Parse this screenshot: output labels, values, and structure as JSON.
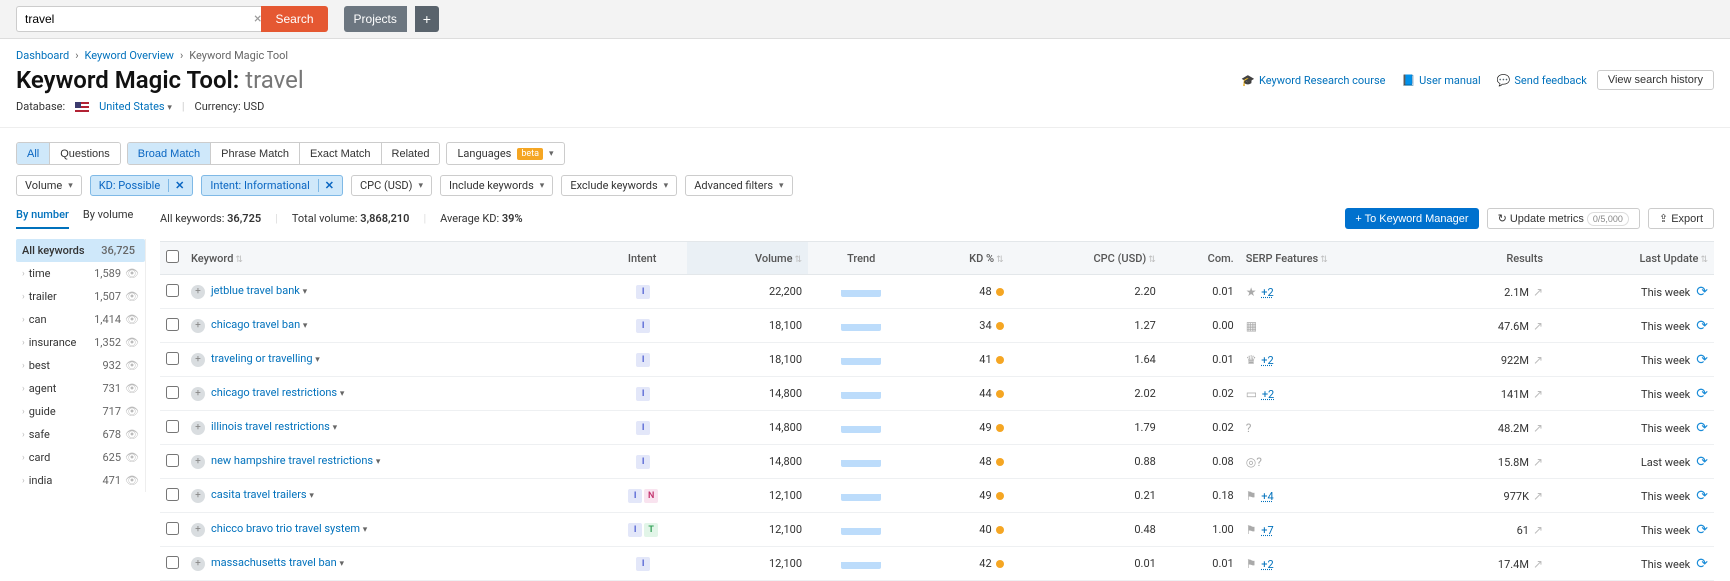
{
  "search": {
    "value": "travel",
    "search_btn": "Search",
    "projects_btn": "Projects"
  },
  "breadcrumb": {
    "a": "Dashboard",
    "b": "Keyword Overview",
    "c": "Keyword Magic Tool"
  },
  "title": {
    "tool": "Keyword Magic Tool:",
    "term": "travel"
  },
  "header_links": {
    "course": "Keyword Research course",
    "manual": "User manual",
    "feedback": "Send feedback",
    "history": "View search history"
  },
  "subhead": {
    "db_label": "Database:",
    "db_value": "United States",
    "cur_label": "Currency:",
    "cur_value": "USD"
  },
  "match_tabs": [
    "All",
    "Questions",
    "Broad Match",
    "Phrase Match",
    "Exact Match",
    "Related"
  ],
  "lang_label": "Languages",
  "filters": {
    "volume": "Volume",
    "kd": "KD: Possible",
    "intent": "Intent: Informational",
    "cpc": "CPC (USD)",
    "include": "Include keywords",
    "exclude": "Exclude keywords",
    "advanced": "Advanced filters"
  },
  "group_meta": {
    "by_number": "By number",
    "by_volume": "By volume",
    "all_keywords": "All keywords",
    "all_count": "36,725"
  },
  "groups": [
    {
      "name": "time",
      "count": "1,589"
    },
    {
      "name": "trailer",
      "count": "1,507"
    },
    {
      "name": "can",
      "count": "1,414"
    },
    {
      "name": "insurance",
      "count": "1,352"
    },
    {
      "name": "best",
      "count": "932"
    },
    {
      "name": "agent",
      "count": "731"
    },
    {
      "name": "guide",
      "count": "717"
    },
    {
      "name": "safe",
      "count": "678"
    },
    {
      "name": "card",
      "count": "625"
    },
    {
      "name": "india",
      "count": "471"
    }
  ],
  "summary": {
    "all_kw_lbl": "All keywords:",
    "all_kw_val": "36,725",
    "tot_vol_lbl": "Total volume:",
    "tot_vol_val": "3,868,210",
    "avg_kd_lbl": "Average KD:",
    "avg_kd_val": "39%",
    "to_km": "To Keyword Manager",
    "update": "Update metrics",
    "update_count": "0/5,000",
    "export": "Export"
  },
  "cols": {
    "keyword": "Keyword",
    "intent": "Intent",
    "volume": "Volume",
    "trend": "Trend",
    "kd": "KD %",
    "cpc": "CPC (USD)",
    "com": "Com.",
    "serp": "SERP Features",
    "results": "Results",
    "last": "Last Update"
  },
  "rows": [
    {
      "kw": "jetblue travel bank",
      "intent": [
        "I"
      ],
      "vol": "22,200",
      "kd": "48",
      "cpc": "2.20",
      "com": "0.01",
      "serp_more": "+2",
      "serp_ico": "★",
      "results": "2.1M",
      "last": "This week"
    },
    {
      "kw": "chicago travel ban",
      "intent": [
        "I"
      ],
      "vol": "18,100",
      "kd": "34",
      "cpc": "1.27",
      "com": "0.00",
      "serp_more": "",
      "serp_ico": "▦",
      "results": "47.6M",
      "last": "This week"
    },
    {
      "kw": "traveling or travelling",
      "intent": [
        "I"
      ],
      "vol": "18,100",
      "kd": "41",
      "cpc": "1.64",
      "com": "0.01",
      "serp_more": "+2",
      "serp_ico": "♛",
      "results": "922M",
      "last": "This week"
    },
    {
      "kw": "chicago travel restrictions",
      "intent": [
        "I"
      ],
      "vol": "14,800",
      "kd": "44",
      "cpc": "2.02",
      "com": "0.02",
      "serp_more": "+2",
      "serp_ico": "▭",
      "results": "141M",
      "last": "This week"
    },
    {
      "kw": "illinois travel restrictions",
      "intent": [
        "I"
      ],
      "vol": "14,800",
      "kd": "49",
      "cpc": "1.79",
      "com": "0.02",
      "serp_more": "",
      "serp_ico": "?",
      "results": "48.2M",
      "last": "This week"
    },
    {
      "kw": "new hampshire travel restrictions",
      "intent": [
        "I"
      ],
      "vol": "14,800",
      "kd": "48",
      "cpc": "0.88",
      "com": "0.08",
      "serp_more": "",
      "serp_ico": "◎?",
      "results": "15.8M",
      "last": "Last week"
    },
    {
      "kw": "casita travel trailers",
      "intent": [
        "I",
        "N"
      ],
      "vol": "12,100",
      "kd": "49",
      "cpc": "0.21",
      "com": "0.18",
      "serp_more": "+4",
      "serp_ico": "⚑",
      "results": "977K",
      "last": "This week"
    },
    {
      "kw": "chicco bravo trio travel system",
      "intent": [
        "I",
        "T"
      ],
      "vol": "12,100",
      "kd": "40",
      "cpc": "0.48",
      "com": "1.00",
      "serp_more": "+7",
      "serp_ico": "⚑",
      "results": "61",
      "last": "This week"
    },
    {
      "kw": "massachusetts travel ban",
      "intent": [
        "I"
      ],
      "vol": "12,100",
      "kd": "42",
      "cpc": "0.01",
      "com": "0.01",
      "serp_more": "+2",
      "serp_ico": "⚑",
      "results": "17.4M",
      "last": "This week"
    }
  ]
}
